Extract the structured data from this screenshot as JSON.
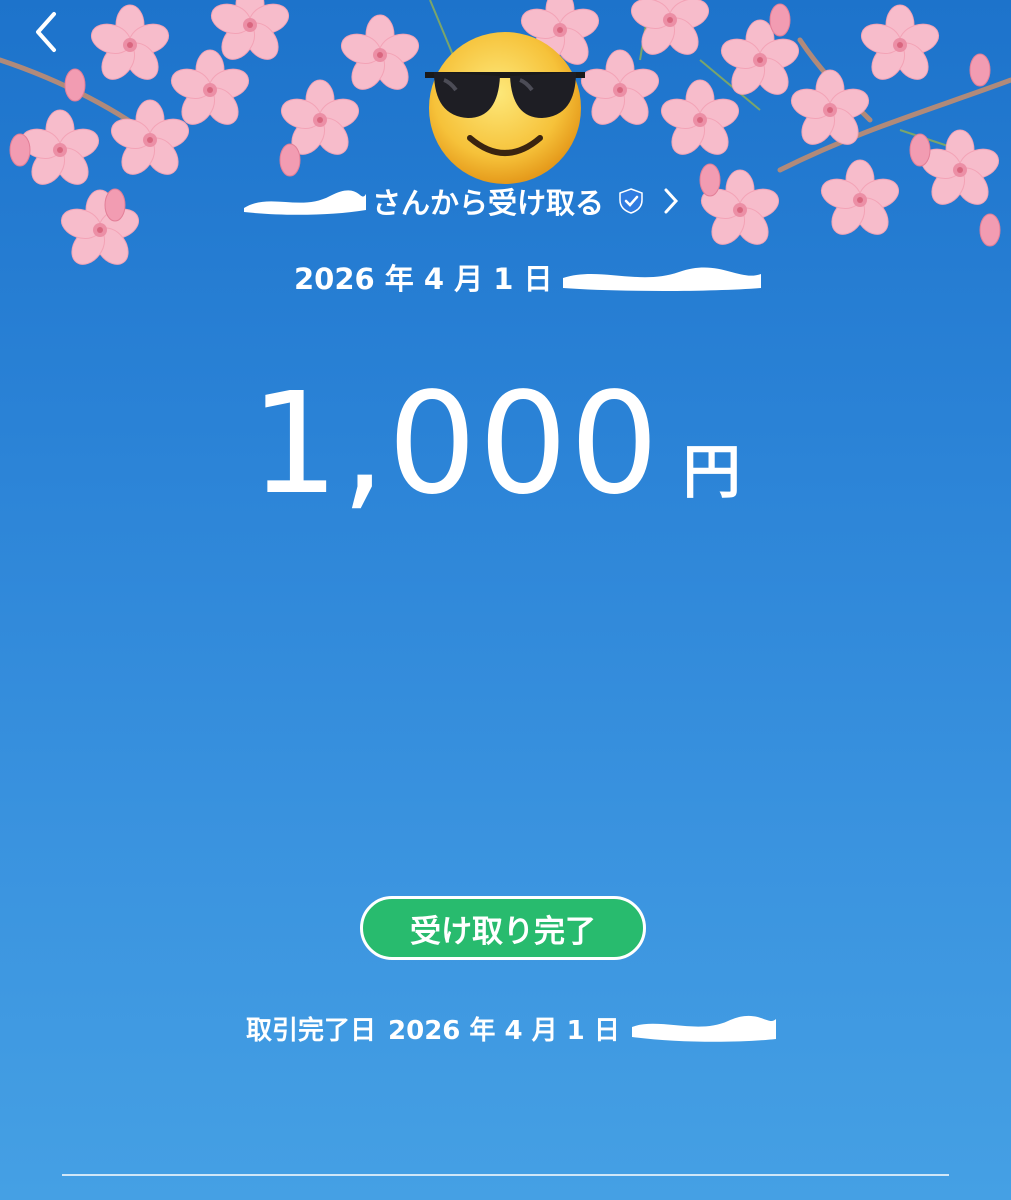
{
  "header": {
    "back_icon": "chevron-left-icon"
  },
  "avatar": {
    "icon": "smiling-face-with-sunglasses-icon"
  },
  "sender": {
    "label_suffix": "さんから受け取る",
    "verified_icon": "verified-shield-icon",
    "chevron_icon": "chevron-right-icon"
  },
  "transaction": {
    "date": "2026 年 4 月 1 日"
  },
  "amount": {
    "value": "1,000",
    "unit": "円"
  },
  "status": {
    "label": "受け取り完了",
    "color": "#28bb6e"
  },
  "completion": {
    "label": "取引完了日",
    "date": "2026 年 4 月 1 日"
  },
  "colors": {
    "background_top": "#1d73cb",
    "background_bottom": "#45a0e4",
    "blossom": "#f6b9c6"
  }
}
